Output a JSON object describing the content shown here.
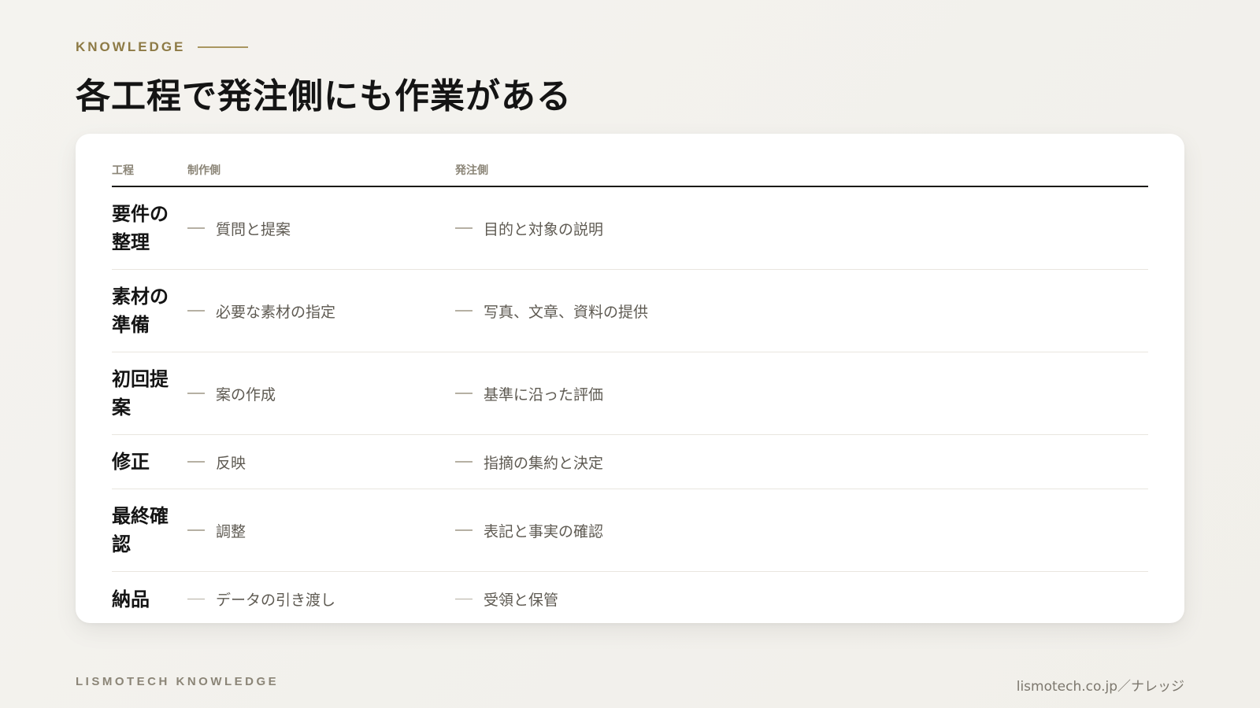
{
  "eyebrow": "KNOWLEDGE",
  "title": "各工程で発注側にも作業がある",
  "table": {
    "headers": {
      "step": "工程",
      "maker": "制作側",
      "client": "発注側"
    },
    "rows": [
      {
        "step": "要件の整理",
        "maker": "質問と提案",
        "client": "目的と対象の説明"
      },
      {
        "step": "素材の準備",
        "maker": "必要な素材の指定",
        "client": "写真、文章、資料の提供"
      },
      {
        "step": "初回提案",
        "maker": "案の作成",
        "client": "基準に沿った評価"
      },
      {
        "step": "修正",
        "maker": "反映",
        "client": "指摘の集約と決定"
      },
      {
        "step": "最終確認",
        "maker": "調整",
        "client": "表記と事実の確認"
      },
      {
        "step": "納品",
        "maker": "データの引き渡し",
        "client": "受領と保管"
      }
    ]
  },
  "footer": {
    "brand": "LISMOTECH KNOWLEDGE",
    "url": "lismotech.co.jp／ナレッジ"
  },
  "colors": {
    "accent": "#8d7a45",
    "background": "#f3f2ee",
    "card": "#ffffff",
    "text": "#141414"
  }
}
